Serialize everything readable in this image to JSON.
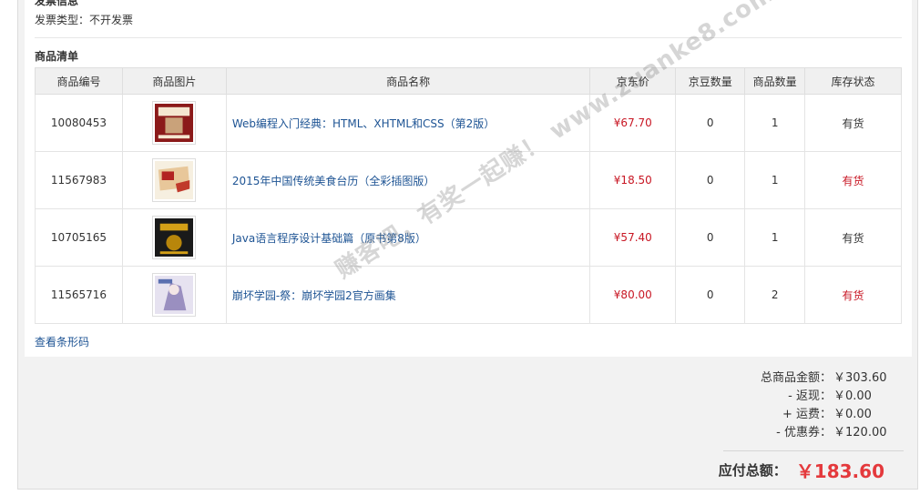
{
  "invoice": {
    "section_title": "发票信息",
    "type_label": "发票类型：",
    "type_value": "不开发票"
  },
  "goods": {
    "section_title": "商品清单",
    "headers": [
      "商品编号",
      "商品图片",
      "商品名称",
      "京东价",
      "京豆数量",
      "商品数量",
      "库存状态"
    ],
    "rows": [
      {
        "id": "10080453",
        "name": "Web编程入门经典：HTML、XHTML和CSS（第2版）",
        "price": "¥67.70",
        "beans": "0",
        "qty": "1",
        "stock": "有货",
        "stock_color": "#333333",
        "cover_color": "#8b1a1a"
      },
      {
        "id": "11567983",
        "name": "2015年中国传统美食台历（全彩插图版）",
        "price": "¥18.50",
        "beans": "0",
        "qty": "1",
        "stock": "有货",
        "stock_color": "#c81623",
        "cover_color": "#d9b48a"
      },
      {
        "id": "10705165",
        "name": "Java语言程序设计基础篇（原书第8版）",
        "price": "¥57.40",
        "beans": "0",
        "qty": "1",
        "stock": "有货",
        "stock_color": "#333333",
        "cover_color": "#1a1a1a"
      },
      {
        "id": "11565716",
        "name": "崩坏学园-祭：崩坏学园2官方画集",
        "price": "¥80.00",
        "beans": "0",
        "qty": "2",
        "stock": "有货",
        "stock_color": "#c81623",
        "cover_color": "#9a8fc0"
      }
    ],
    "barcode_link": "查看条形码"
  },
  "summary": {
    "items": [
      {
        "label": "总商品金额：",
        "value": "￥303.60"
      },
      {
        "label": "- 返现：",
        "value": "￥0.00"
      },
      {
        "label": "+ 运费：",
        "value": "￥0.00"
      },
      {
        "label": "- 优惠券：",
        "value": "￥120.00"
      }
    ],
    "total_label": "应付总额：",
    "total_value": "￥183.60"
  },
  "watermark": "赚客吧，有奖一起赚！ www.zuanke8.com"
}
